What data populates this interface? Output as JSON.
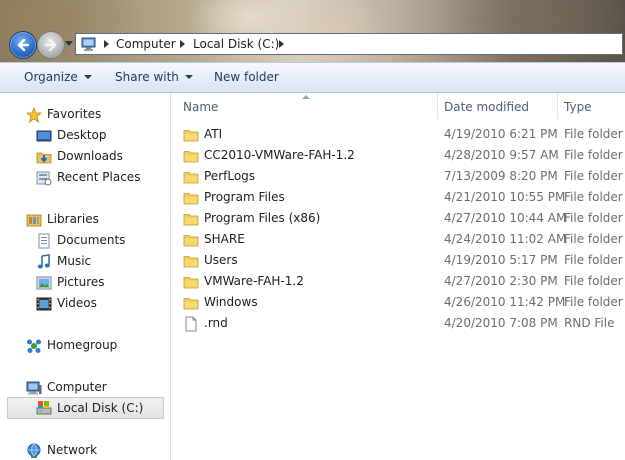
{
  "address": {
    "segments": [
      "Computer",
      "Local Disk (C:)"
    ]
  },
  "toolbar": {
    "organize": "Organize",
    "share_with": "Share with",
    "new_folder": "New folder"
  },
  "nav": {
    "favorites": {
      "label": "Favorites",
      "items": [
        "Desktop",
        "Downloads",
        "Recent Places"
      ]
    },
    "libraries": {
      "label": "Libraries",
      "items": [
        "Documents",
        "Music",
        "Pictures",
        "Videos"
      ]
    },
    "homegroup": "Homegroup",
    "computer": {
      "label": "Computer",
      "items": [
        "Local Disk (C:)"
      ]
    },
    "network": "Network"
  },
  "columns": {
    "name": "Name",
    "date_modified": "Date modified",
    "type": "Type"
  },
  "files": [
    {
      "name": "ATI",
      "date": "4/19/2010 6:21 PM",
      "type": "File folder",
      "icon": "folder-icon"
    },
    {
      "name": "CC2010-VMWare-FAH-1.2",
      "date": "4/28/2010 9:57 AM",
      "type": "File folder",
      "icon": "folder-icon"
    },
    {
      "name": "PerfLogs",
      "date": "7/13/2009 8:20 PM",
      "type": "File folder",
      "icon": "folder-icon"
    },
    {
      "name": "Program Files",
      "date": "4/21/2010 10:55 PM",
      "type": "File folder",
      "icon": "folder-icon"
    },
    {
      "name": "Program Files (x86)",
      "date": "4/27/2010 10:44 AM",
      "type": "File folder",
      "icon": "folder-icon"
    },
    {
      "name": "SHARE",
      "date": "4/24/2010 11:02 AM",
      "type": "File folder",
      "icon": "folder-icon"
    },
    {
      "name": "Users",
      "date": "4/19/2010 5:17 PM",
      "type": "File folder",
      "icon": "folder-icon"
    },
    {
      "name": "VMWare-FAH-1.2",
      "date": "4/27/2010 2:30 PM",
      "type": "File folder",
      "icon": "folder-icon"
    },
    {
      "name": "Windows",
      "date": "4/26/2010 11:42 PM",
      "type": "File folder",
      "icon": "folder-icon"
    },
    {
      "name": ".rnd",
      "date": "4/20/2010 7:08 PM",
      "type": "RND File",
      "icon": "file-icon"
    }
  ]
}
